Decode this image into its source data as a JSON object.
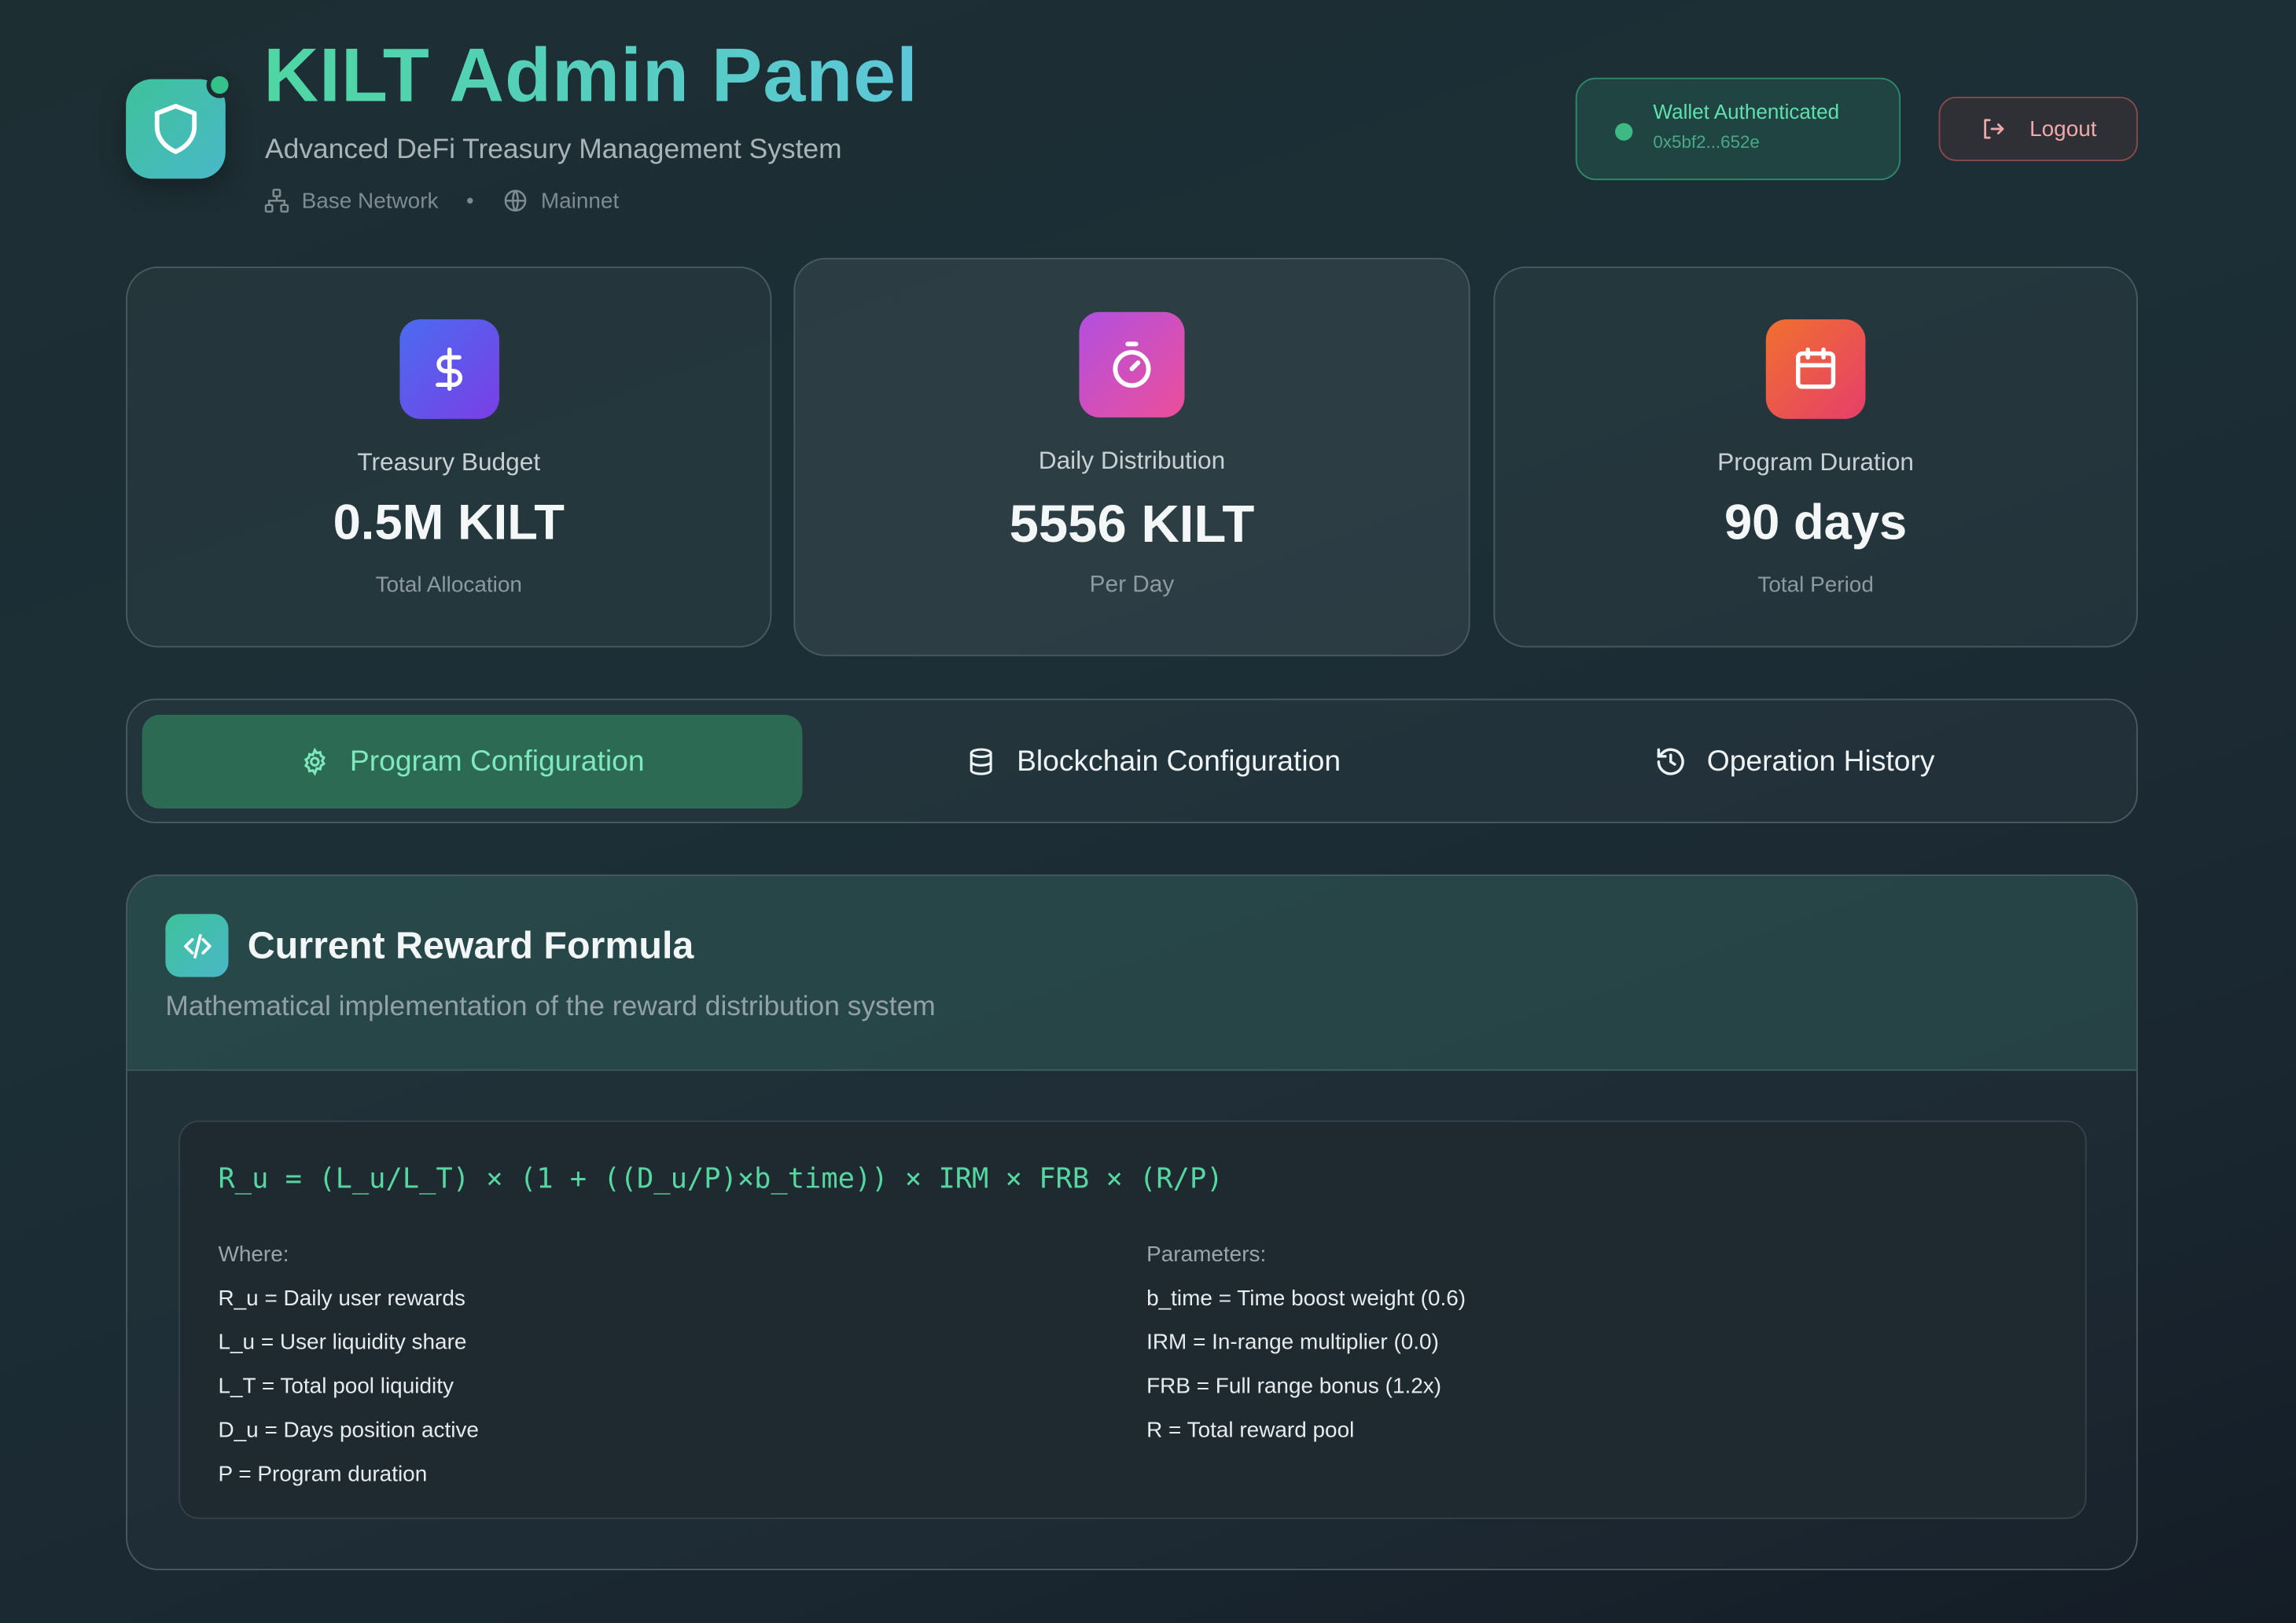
{
  "header": {
    "title": "KILT Admin Panel",
    "subtitle": "Advanced DeFi Treasury Management System",
    "network": "Base Network",
    "environment": "Mainnet",
    "logo_icon": "shield-icon"
  },
  "wallet": {
    "status": "Wallet Authenticated",
    "address": "0x5bf2...652e",
    "status_color": "#3fb984"
  },
  "logout": {
    "label": "Logout"
  },
  "stats": [
    {
      "label": "Treasury Budget",
      "value": "0.5M KILT",
      "sub": "Total Allocation",
      "icon": "dollar-icon"
    },
    {
      "label": "Daily Distribution",
      "value": "5556 KILT",
      "sub": "Per Day",
      "icon": "stopwatch-icon"
    },
    {
      "label": "Program Duration",
      "value": "90 days",
      "sub": "Total Period",
      "icon": "calendar-icon"
    }
  ],
  "tabs": [
    {
      "label": "Program Configuration",
      "icon": "gear-icon",
      "active": true
    },
    {
      "label": "Blockchain Configuration",
      "icon": "database-icon",
      "active": false
    },
    {
      "label": "Operation History",
      "icon": "history-icon",
      "active": false
    }
  ],
  "formula_panel": {
    "title": "Current Reward Formula",
    "subtitle": "Mathematical implementation of the reward distribution system",
    "formula": "R_u = (L_u/L_T) × (1 + ((D_u/P)×b_time)) × IRM × FRB × (R/P)",
    "where_heading": "Where:",
    "where": [
      "R_u = Daily user rewards",
      "L_u = User liquidity share",
      "L_T = Total pool liquidity",
      "D_u = Days position active",
      "P = Program duration"
    ],
    "params_heading": "Parameters:",
    "params": [
      "b_time = Time boost weight (0.6)",
      "IRM = In-range multiplier (0.0)",
      "FRB = Full range bonus (1.2x)",
      "R = Total reward pool"
    ]
  },
  "colors": {
    "accent": "#3ec29a",
    "active_tab": "#2d6a54",
    "logout": "#f0a8a8"
  }
}
